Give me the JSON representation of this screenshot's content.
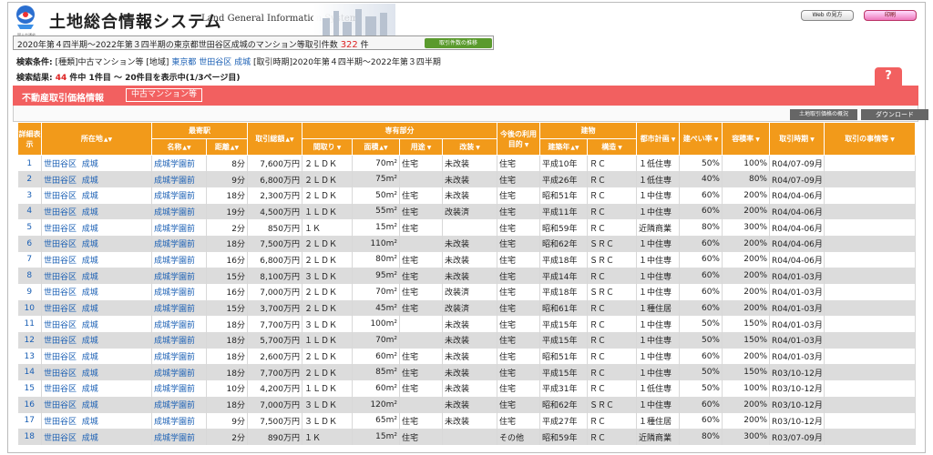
{
  "header": {
    "logo_caption": "国土交通省",
    "title": "土地総合情報システム",
    "title_en": "Land General Information System",
    "web_button": "Web の見方",
    "print_button": "印刷",
    "count_prefix": "2020年第４四半期～2022年第３四半期の東京都世田谷区成城のマンション等取引件数",
    "count_value": "322",
    "count_suffix": "件",
    "trend_button": "取引件数の推移"
  },
  "conditions": {
    "label": "検索条件:",
    "type_label": "[種類]",
    "type_value": "中古マンション等",
    "area_label": "[地域]",
    "pref": "東京都",
    "city": "世田谷区",
    "town": "成城",
    "period_label": "[取引時期]",
    "period_value": "2020年第４四半期～2022年第３四半期"
  },
  "result": {
    "label": "検索結果:",
    "count": "44",
    "text": "件中 1件目 〜 20件目を表示中(1/3ページ目)"
  },
  "band": {
    "title": "不動産取引価格情報",
    "tag": "中古マンション等",
    "help": "?"
  },
  "toolbar": {
    "overview": "土地取引価格の概況",
    "download": "ダウンロード"
  },
  "columns": {
    "detail": "詳細表示",
    "location": "所在地",
    "station": "最寄駅",
    "station_name": "名称",
    "station_dist": "距離",
    "price": "取引総額",
    "exclusive": "専有部分",
    "layout": "間取り",
    "area": "面積",
    "use": "用途",
    "renovation": "改装",
    "future_use": "今後の利用目的",
    "building": "建物",
    "built_year": "建築年",
    "structure": "構造",
    "city_plan": "都市計画",
    "coverage": "建ぺい率",
    "far": "容積率",
    "period": "取引時期",
    "circumstances": "取引の事情等"
  },
  "rows": [
    {
      "no": "1",
      "ward": "世田谷区",
      "town": "成城",
      "station": "成城学園前",
      "dist": "8分",
      "price": "7,600万円",
      "layout": "２ＬＤＫ",
      "area": "70m²",
      "use": "住宅",
      "renov": "未改装",
      "future": "住宅",
      "year": "平成10年",
      "struct": "ＲＣ",
      "plan": "１低住専",
      "bcr": "50%",
      "far": "100%",
      "period": "R04/07-09月",
      "note": ""
    },
    {
      "no": "2",
      "ward": "世田谷区",
      "town": "成城",
      "station": "成城学園前",
      "dist": "9分",
      "price": "6,800万円",
      "layout": "２ＬＤＫ",
      "area": "75m²",
      "use": "",
      "renov": "未改装",
      "future": "住宅",
      "year": "平成26年",
      "struct": "ＲＣ",
      "plan": "１低住専",
      "bcr": "40%",
      "far": "80%",
      "period": "R04/07-09月",
      "note": ""
    },
    {
      "no": "3",
      "ward": "世田谷区",
      "town": "成城",
      "station": "成城学園前",
      "dist": "18分",
      "price": "2,300万円",
      "layout": "２ＬＤＫ",
      "area": "50m²",
      "use": "住宅",
      "renov": "未改装",
      "future": "住宅",
      "year": "昭和51年",
      "struct": "ＲＣ",
      "plan": "１中住専",
      "bcr": "60%",
      "far": "200%",
      "period": "R04/04-06月",
      "note": ""
    },
    {
      "no": "4",
      "ward": "世田谷区",
      "town": "成城",
      "station": "成城学園前",
      "dist": "19分",
      "price": "4,500万円",
      "layout": "１ＬＤＫ",
      "area": "55m²",
      "use": "住宅",
      "renov": "改装済",
      "future": "住宅",
      "year": "平成11年",
      "struct": "ＲＣ",
      "plan": "１中住専",
      "bcr": "60%",
      "far": "200%",
      "period": "R04/04-06月",
      "note": ""
    },
    {
      "no": "5",
      "ward": "世田谷区",
      "town": "成城",
      "station": "成城学園前",
      "dist": "2分",
      "price": "850万円",
      "layout": "１Ｋ",
      "area": "15m²",
      "use": "住宅",
      "renov": "",
      "future": "住宅",
      "year": "昭和59年",
      "struct": "ＲＣ",
      "plan": "近隣商業",
      "bcr": "80%",
      "far": "300%",
      "period": "R04/04-06月",
      "note": ""
    },
    {
      "no": "6",
      "ward": "世田谷区",
      "town": "成城",
      "station": "成城学園前",
      "dist": "18分",
      "price": "7,500万円",
      "layout": "２ＬＤＫ",
      "area": "110m²",
      "use": "",
      "renov": "未改装",
      "future": "住宅",
      "year": "昭和62年",
      "struct": "ＳＲＣ",
      "plan": "１中住専",
      "bcr": "60%",
      "far": "200%",
      "period": "R04/04-06月",
      "note": ""
    },
    {
      "no": "7",
      "ward": "世田谷区",
      "town": "成城",
      "station": "成城学園前",
      "dist": "16分",
      "price": "6,800万円",
      "layout": "２ＬＤＫ",
      "area": "80m²",
      "use": "住宅",
      "renov": "未改装",
      "future": "住宅",
      "year": "平成18年",
      "struct": "ＳＲＣ",
      "plan": "１中住専",
      "bcr": "60%",
      "far": "200%",
      "period": "R04/04-06月",
      "note": ""
    },
    {
      "no": "8",
      "ward": "世田谷区",
      "town": "成城",
      "station": "成城学園前",
      "dist": "15分",
      "price": "8,100万円",
      "layout": "３ＬＤＫ",
      "area": "95m²",
      "use": "住宅",
      "renov": "未改装",
      "future": "住宅",
      "year": "平成14年",
      "struct": "ＲＣ",
      "plan": "１中住専",
      "bcr": "60%",
      "far": "200%",
      "period": "R04/01-03月",
      "note": ""
    },
    {
      "no": "9",
      "ward": "世田谷区",
      "town": "成城",
      "station": "成城学園前",
      "dist": "16分",
      "price": "7,000万円",
      "layout": "２ＬＤＫ",
      "area": "70m²",
      "use": "住宅",
      "renov": "改装済",
      "future": "住宅",
      "year": "平成18年",
      "struct": "ＳＲＣ",
      "plan": "１中住専",
      "bcr": "60%",
      "far": "200%",
      "period": "R04/01-03月",
      "note": ""
    },
    {
      "no": "10",
      "ward": "世田谷区",
      "town": "成城",
      "station": "成城学園前",
      "dist": "15分",
      "price": "3,700万円",
      "layout": "２ＬＤＫ",
      "area": "45m²",
      "use": "住宅",
      "renov": "改装済",
      "future": "住宅",
      "year": "昭和61年",
      "struct": "ＲＣ",
      "plan": "１種住居",
      "bcr": "60%",
      "far": "200%",
      "period": "R04/01-03月",
      "note": ""
    },
    {
      "no": "11",
      "ward": "世田谷区",
      "town": "成城",
      "station": "成城学園前",
      "dist": "18分",
      "price": "7,700万円",
      "layout": "３ＬＤＫ",
      "area": "100m²",
      "use": "",
      "renov": "未改装",
      "future": "住宅",
      "year": "平成15年",
      "struct": "ＲＣ",
      "plan": "１中住専",
      "bcr": "50%",
      "far": "150%",
      "period": "R04/01-03月",
      "note": ""
    },
    {
      "no": "12",
      "ward": "世田谷区",
      "town": "成城",
      "station": "成城学園前",
      "dist": "18分",
      "price": "5,700万円",
      "layout": "１ＬＤＫ",
      "area": "70m²",
      "use": "",
      "renov": "未改装",
      "future": "住宅",
      "year": "平成15年",
      "struct": "ＲＣ",
      "plan": "１中住専",
      "bcr": "50%",
      "far": "150%",
      "period": "R04/01-03月",
      "note": ""
    },
    {
      "no": "13",
      "ward": "世田谷区",
      "town": "成城",
      "station": "成城学園前",
      "dist": "18分",
      "price": "2,600万円",
      "layout": "２ＬＤＫ",
      "area": "60m²",
      "use": "住宅",
      "renov": "未改装",
      "future": "住宅",
      "year": "昭和51年",
      "struct": "ＲＣ",
      "plan": "１中住専",
      "bcr": "60%",
      "far": "200%",
      "period": "R04/01-03月",
      "note": ""
    },
    {
      "no": "14",
      "ward": "世田谷区",
      "town": "成城",
      "station": "成城学園前",
      "dist": "18分",
      "price": "7,700万円",
      "layout": "２ＬＤＫ",
      "area": "85m²",
      "use": "住宅",
      "renov": "未改装",
      "future": "住宅",
      "year": "平成15年",
      "struct": "ＲＣ",
      "plan": "１中住専",
      "bcr": "50%",
      "far": "150%",
      "period": "R03/10-12月",
      "note": ""
    },
    {
      "no": "15",
      "ward": "世田谷区",
      "town": "成城",
      "station": "成城学園前",
      "dist": "10分",
      "price": "4,200万円",
      "layout": "１ＬＤＫ",
      "area": "60m²",
      "use": "住宅",
      "renov": "未改装",
      "future": "住宅",
      "year": "平成31年",
      "struct": "ＲＣ",
      "plan": "１低住専",
      "bcr": "50%",
      "far": "100%",
      "period": "R03/10-12月",
      "note": ""
    },
    {
      "no": "16",
      "ward": "世田谷区",
      "town": "成城",
      "station": "成城学園前",
      "dist": "18分",
      "price": "7,000万円",
      "layout": "３ＬＤＫ",
      "area": "120m²",
      "use": "",
      "renov": "未改装",
      "future": "住宅",
      "year": "昭和62年",
      "struct": "ＳＲＣ",
      "plan": "１中住専",
      "bcr": "60%",
      "far": "200%",
      "period": "R03/10-12月",
      "note": ""
    },
    {
      "no": "17",
      "ward": "世田谷区",
      "town": "成城",
      "station": "成城学園前",
      "dist": "9分",
      "price": "7,500万円",
      "layout": "３ＬＤＫ",
      "area": "65m²",
      "use": "住宅",
      "renov": "未改装",
      "future": "住宅",
      "year": "平成27年",
      "struct": "ＲＣ",
      "plan": "１種住居",
      "bcr": "60%",
      "far": "200%",
      "period": "R03/10-12月",
      "note": ""
    },
    {
      "no": "18",
      "ward": "世田谷区",
      "town": "成城",
      "station": "成城学園前",
      "dist": "2分",
      "price": "890万円",
      "layout": "１Ｋ",
      "area": "15m²",
      "use": "住宅",
      "renov": "",
      "future": "その他",
      "year": "昭和59年",
      "struct": "ＲＣ",
      "plan": "近隣商業",
      "bcr": "80%",
      "far": "300%",
      "period": "R03/07-09月",
      "note": ""
    }
  ]
}
